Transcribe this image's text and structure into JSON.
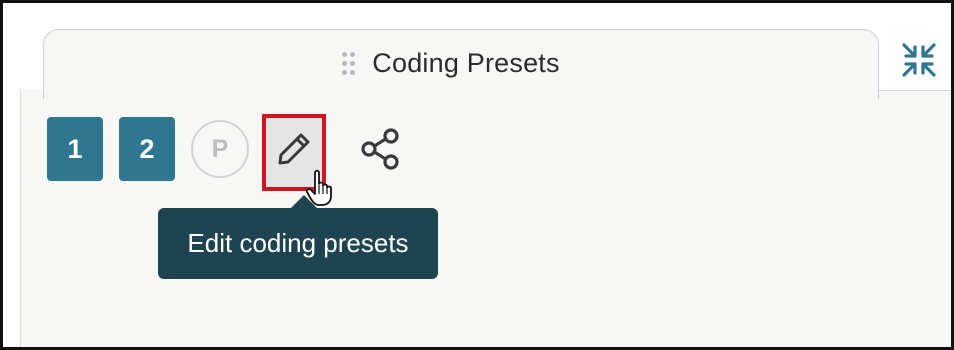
{
  "panel": {
    "title": "Coding Presets",
    "drag_handle_icon": "drag-handle-icon",
    "collapse_icon": "collapse-arrows-icon"
  },
  "toolbar": {
    "presets": [
      {
        "label": "1",
        "style": "filled"
      },
      {
        "label": "2",
        "style": "filled"
      },
      {
        "label": "P",
        "style": "outline-circle"
      }
    ],
    "edit_icon": "pencil-icon",
    "share_icon": "share-icon"
  },
  "tooltip": {
    "text": "Edit coding presets"
  },
  "colors": {
    "accent": "#2f7790",
    "tooltip_bg": "#1e4452",
    "highlight_box": "#d0161f",
    "collapse_icon": "#2f7790"
  }
}
